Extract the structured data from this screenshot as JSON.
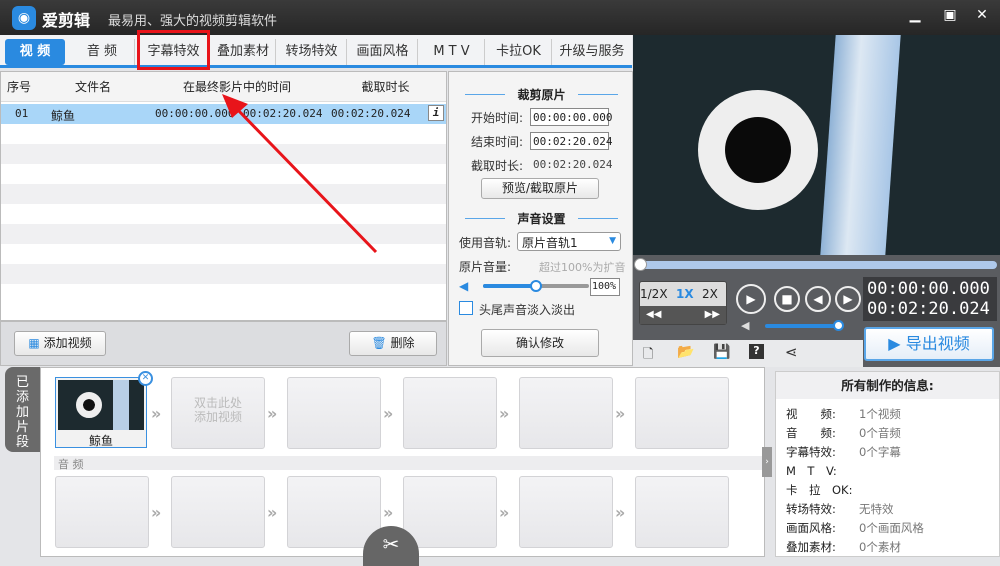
{
  "app": {
    "name": "爱剪辑",
    "slogan": "最易用、强大的视频剪辑软件"
  },
  "tabs": [
    "视 频",
    "音 频",
    "字幕特效",
    "叠加素材",
    "转场特效",
    "画面风格",
    "M T V",
    "卡拉OK",
    "升级与服务"
  ],
  "table": {
    "headers": [
      "序号",
      "文件名",
      "在最终影片中的时间",
      "截取时长"
    ],
    "rows": [
      {
        "index": "01",
        "name": "鲸鱼",
        "start": "00:00:00.000",
        "end": "00:02:20.024",
        "duration": "00:02:20.024"
      }
    ]
  },
  "left_buttons": {
    "add": "添加视频",
    "delete": "删除"
  },
  "crop": {
    "title": "裁剪原片",
    "start_label": "开始时间:",
    "start_value": "00:00:00.000",
    "end_label": "结束时间:",
    "end_value": "00:02:20.024",
    "dur_label": "截取时长:",
    "dur_value": "00:02:20.024",
    "preview_button": "预览/截取原片"
  },
  "audio": {
    "title": "声音设置",
    "track_label": "使用音轨:",
    "track_value": "原片音轨1",
    "volume_label": "原片音量:",
    "volume_hint": "超过100%为扩音",
    "volume_value": "100%",
    "volume_percent": 100,
    "fade_label": "头尾声音淡入淡出",
    "fade_checked": false,
    "confirm_button": "确认修改"
  },
  "player": {
    "speeds": [
      "1/2X",
      "1X",
      "2X"
    ],
    "selected_speed": "1X",
    "current_time": "00:00:00.000",
    "total_time": "00:02:20.024",
    "progress": 0,
    "export_button": "导出视频"
  },
  "timeline": {
    "side_tab": "已添加片段",
    "clip_name": "鲸鱼",
    "empty_hint_1": "双击此处",
    "empty_hint_2": "添加视频",
    "audio_label": "音 频"
  },
  "info": {
    "title": "所有制作的信息:",
    "items": [
      {
        "k": "视　　频:",
        "v": "1个视频"
      },
      {
        "k": "音　　频:",
        "v": "0个音频"
      },
      {
        "k": "字幕特效:",
        "v": "0个字幕"
      },
      {
        "k": "M　T　V:",
        "v": ""
      },
      {
        "k": "卡　拉　OK:",
        "v": ""
      },
      {
        "k": "转场特效:",
        "v": "无特效"
      },
      {
        "k": "画面风格:",
        "v": "0个画面风格"
      },
      {
        "k": "叠加素材:",
        "v": "0个素材"
      }
    ]
  },
  "colors": {
    "accent": "#2a8ae0",
    "annotation": "#e8141a",
    "selected_row": "#a9d6f8"
  }
}
